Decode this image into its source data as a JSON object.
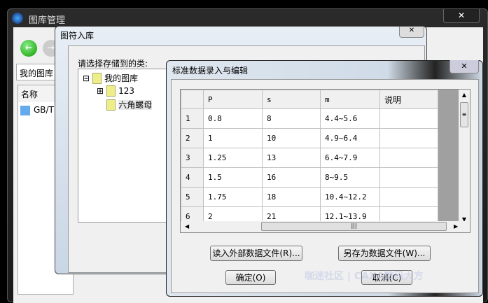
{
  "main_window": {
    "title": "图库管理",
    "close": "✕",
    "path": "我的图库",
    "list_header": "名称",
    "list_item": "GB/T"
  },
  "insert_dialog": {
    "title": "图符入库",
    "prompt": "请选择存储到的类:",
    "tree": {
      "root": "我的图库",
      "children": [
        "123",
        "六角螺母"
      ],
      "selected": "六角螺母"
    }
  },
  "data_dialog": {
    "title": "标准数据录入与编辑",
    "close": "✕",
    "columns": [
      "P",
      "s",
      "m",
      "说明"
    ],
    "rows": [
      {
        "n": "1",
        "P": "0.8",
        "s": "8",
        "m": "4.4~5.6",
        "note": ""
      },
      {
        "n": "2",
        "P": "1",
        "s": "10",
        "m": "4.9~6.4",
        "note": ""
      },
      {
        "n": "3",
        "P": "1.25",
        "s": "13",
        "m": "6.4~7.9",
        "note": ""
      },
      {
        "n": "4",
        "P": "1.5",
        "s": "16",
        "m": "8~9.5",
        "note": ""
      },
      {
        "n": "5",
        "P": "1.75",
        "s": "18",
        "m": "10.4~12.2",
        "note": ""
      },
      {
        "n": "6",
        "P": "2",
        "s": "21",
        "m": "12.1~13.9",
        "note": ""
      }
    ],
    "buttons": {
      "read": "读入外部数据文件(R)...",
      "save_as": "另存为数据文件(W)...",
      "ok": "确定(O)",
      "cancel": "取消(C)"
    }
  },
  "watermark": "咖迷社区 | CAXA数码大方"
}
